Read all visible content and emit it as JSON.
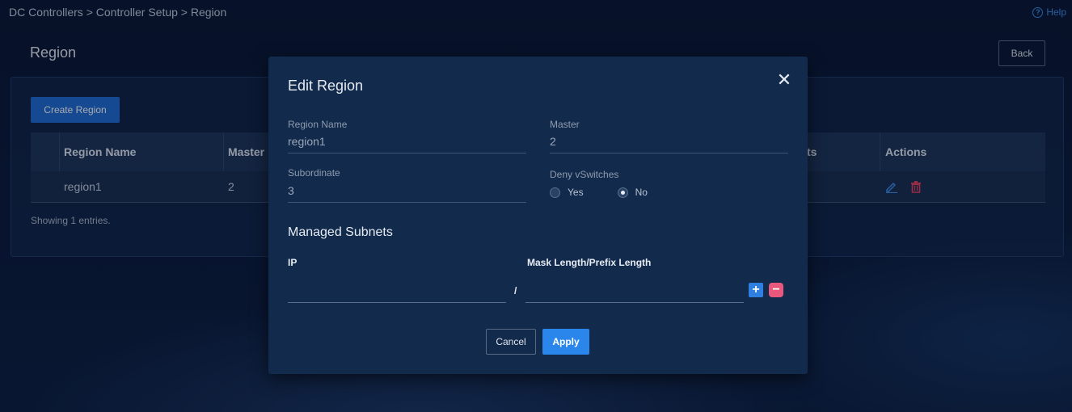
{
  "breadcrumb": "DC Controllers > Controller Setup > Region",
  "help": {
    "label": "Help",
    "icon": "help-circle-icon"
  },
  "page": {
    "title": "Region",
    "back_label": "Back"
  },
  "toolbar": {
    "create_label": "Create Region"
  },
  "table": {
    "columns": [
      "Region Name",
      "Master",
      "ts",
      "Actions"
    ],
    "rows": [
      {
        "name": "region1",
        "master": "2"
      }
    ],
    "action_icons": [
      "edit-icon",
      "delete-icon"
    ],
    "footer": "Showing 1 entries."
  },
  "modal": {
    "title": "Edit Region",
    "close_icon": "close-icon",
    "fields": {
      "region_name": {
        "label": "Region Name",
        "value": "region1"
      },
      "master": {
        "label": "Master",
        "value": "2"
      },
      "subordinate": {
        "label": "Subordinate",
        "value": "3"
      },
      "deny_vswitches": {
        "label": "Deny vSwitches",
        "options": [
          "Yes",
          "No"
        ],
        "selected": "No"
      }
    },
    "managed_subnets": {
      "title": "Managed Subnets",
      "ip_label": "IP",
      "mask_label": "Mask Length/Prefix Length",
      "separator": "/",
      "ip_value": "",
      "mask_value": ""
    },
    "cancel_label": "Cancel",
    "apply_label": "Apply"
  },
  "colors": {
    "primary": "#1e6bd0",
    "apply": "#2a86ea",
    "danger": "#e8587c",
    "modal_bg": "#122a4c"
  }
}
